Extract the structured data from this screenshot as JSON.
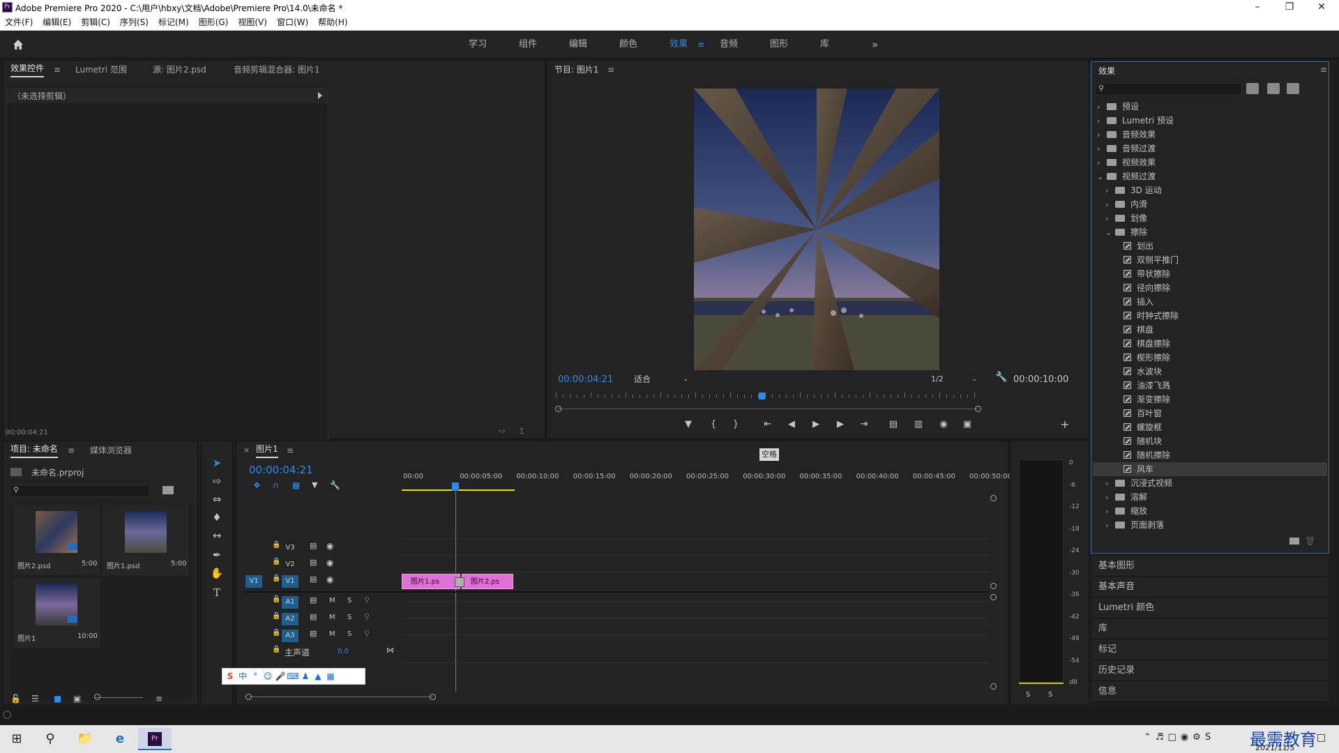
{
  "app": {
    "title": "Adobe Premiere Pro 2020 - C:\\用户\\hbxy\\文档\\Adobe\\Premiere Pro\\14.0\\未命名 *",
    "icon": "Pr"
  },
  "menu": [
    "文件(F)",
    "编辑(E)",
    "剪辑(C)",
    "序列(S)",
    "标记(M)",
    "图形(G)",
    "视图(V)",
    "窗口(W)",
    "帮助(H)"
  ],
  "workspaces": {
    "items": [
      "学习",
      "组件",
      "编辑",
      "颜色",
      "效果",
      "音频",
      "图形",
      "库"
    ],
    "active": "效果",
    "more": "»"
  },
  "source_panel": {
    "tabs": [
      "效果控件",
      "Lumetri 范围",
      "源: 图片2.psd",
      "音频剪辑混合器: 图片1"
    ],
    "no_clip": "（未选择剪辑）",
    "timecode": "00:00:04:21"
  },
  "program": {
    "tab": "节目: 图片1",
    "timecode": "00:00:04:21",
    "fit": "适合",
    "resolution": "1/2",
    "duration": "00:00:10:00",
    "playhead_fraction": 0.48
  },
  "effects": {
    "title": "效果",
    "tree": [
      {
        "label": "预设",
        "level": 0,
        "type": "folder",
        "open": false
      },
      {
        "label": "Lumetri 预设",
        "level": 0,
        "type": "folder",
        "open": false
      },
      {
        "label": "音频效果",
        "level": 0,
        "type": "folder",
        "open": false
      },
      {
        "label": "音频过渡",
        "level": 0,
        "type": "folder",
        "open": false
      },
      {
        "label": "视频效果",
        "level": 0,
        "type": "folder",
        "open": false
      },
      {
        "label": "视频过渡",
        "level": 0,
        "type": "folder",
        "open": true
      },
      {
        "label": "3D 运动",
        "level": 1,
        "type": "folder",
        "open": false
      },
      {
        "label": "内滑",
        "level": 1,
        "type": "folder",
        "open": false
      },
      {
        "label": "划像",
        "level": 1,
        "type": "folder",
        "open": false
      },
      {
        "label": "擦除",
        "level": 1,
        "type": "folder",
        "open": true
      },
      {
        "label": "划出",
        "level": 2,
        "type": "effect"
      },
      {
        "label": "双侧平推门",
        "level": 2,
        "type": "effect"
      },
      {
        "label": "带状擦除",
        "level": 2,
        "type": "effect"
      },
      {
        "label": "径向擦除",
        "level": 2,
        "type": "effect"
      },
      {
        "label": "插入",
        "level": 2,
        "type": "effect"
      },
      {
        "label": "时钟式擦除",
        "level": 2,
        "type": "effect"
      },
      {
        "label": "棋盘",
        "level": 2,
        "type": "effect"
      },
      {
        "label": "棋盘擦除",
        "level": 2,
        "type": "effect"
      },
      {
        "label": "楔形擦除",
        "level": 2,
        "type": "effect"
      },
      {
        "label": "水波块",
        "level": 2,
        "type": "effect"
      },
      {
        "label": "油漆飞溅",
        "level": 2,
        "type": "effect"
      },
      {
        "label": "渐变擦除",
        "level": 2,
        "type": "effect"
      },
      {
        "label": "百叶窗",
        "level": 2,
        "type": "effect"
      },
      {
        "label": "螺旋框",
        "level": 2,
        "type": "effect"
      },
      {
        "label": "随机块",
        "level": 2,
        "type": "effect"
      },
      {
        "label": "随机擦除",
        "level": 2,
        "type": "effect"
      },
      {
        "label": "风车",
        "level": 2,
        "type": "effect",
        "selected": true
      },
      {
        "label": "沉浸式视频",
        "level": 1,
        "type": "folder",
        "open": false
      },
      {
        "label": "溶解",
        "level": 1,
        "type": "folder",
        "open": false
      },
      {
        "label": "缩放",
        "level": 1,
        "type": "folder",
        "open": false
      },
      {
        "label": "页面剥落",
        "level": 1,
        "type": "folder",
        "open": false
      }
    ]
  },
  "side_panels": [
    "基本图形",
    "基本声音",
    "Lumetri 颜色",
    "库",
    "标记",
    "历史记录",
    "信息"
  ],
  "project": {
    "tabs": [
      "项目: 未命名",
      "媒体浏览器"
    ],
    "file": "未命名.prproj",
    "items": [
      {
        "name": "图片2.psd",
        "duration": "5:00"
      },
      {
        "name": "图片1.psd",
        "duration": "5:00"
      },
      {
        "name": "图片1",
        "duration": "10:00"
      }
    ]
  },
  "timeline": {
    "tab": "图片1",
    "timecode": "00:00:04:21",
    "tooltip": "空格",
    "ruler": [
      "00:00",
      "00:00:05:00",
      "00:00:10:00",
      "00:00:15:00",
      "00:00:20:00",
      "00:00:25:00",
      "00:00:30:00",
      "00:00:35:00",
      "00:00:40:00",
      "00:00:45:00",
      "00:00:50:00"
    ],
    "video_tracks": [
      "V3",
      "V2",
      "V1"
    ],
    "audio_tracks": [
      "A1",
      "A2",
      "A3"
    ],
    "source_patch": "V1",
    "master": "主声道",
    "master_value": "0.0",
    "clips": [
      "图片1.ps",
      "图片2.ps"
    ],
    "track_buttons": {
      "mute": "M",
      "solo": "S"
    }
  },
  "meter": {
    "scale": [
      "0",
      "-6",
      "-12",
      "-18",
      "-24",
      "-30",
      "-36",
      "-42",
      "-48",
      "-54",
      "dB"
    ],
    "solo": [
      "S",
      "S"
    ]
  },
  "taskbar": {
    "date": "2021/11/5",
    "watermark": "最需教育"
  }
}
